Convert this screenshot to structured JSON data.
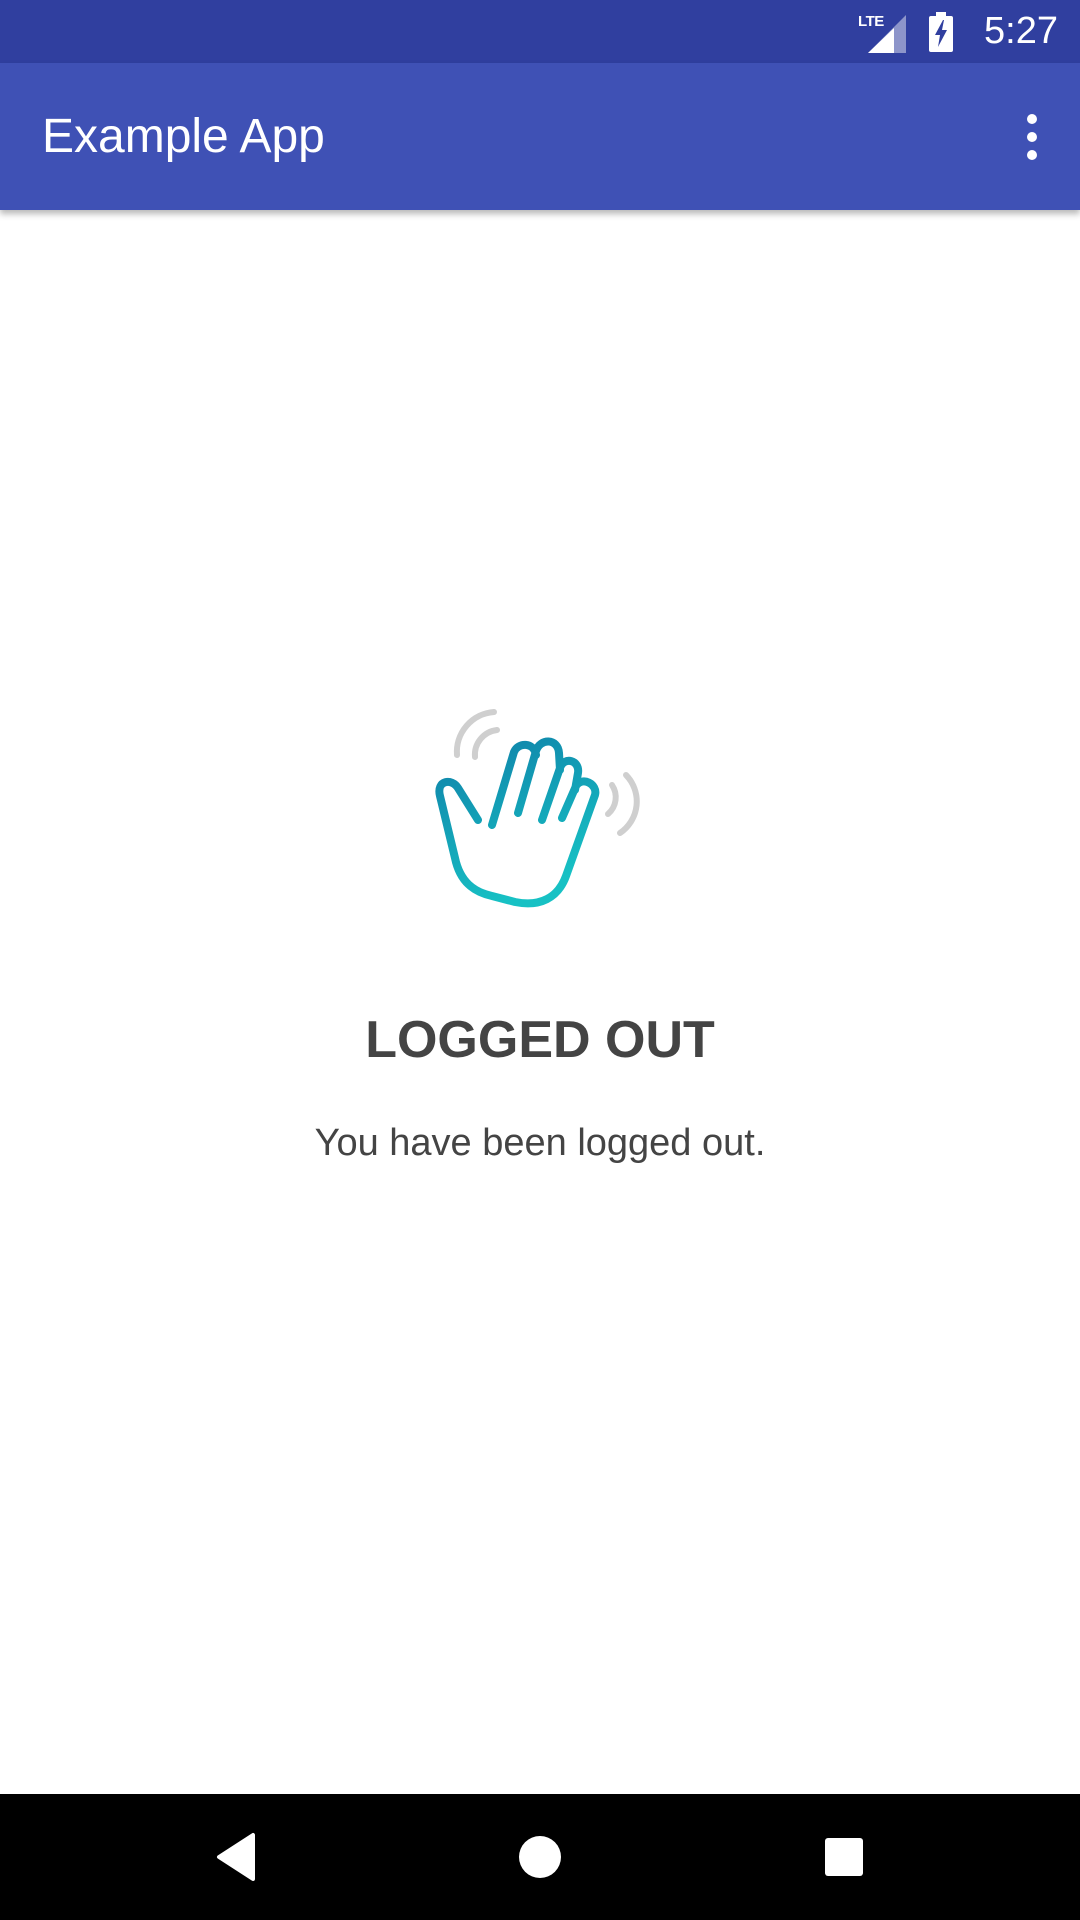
{
  "status_bar": {
    "network_label": "LTE",
    "time": "5:27",
    "background_color": "#303F9F",
    "icons": [
      "lte-signal-icon",
      "battery-charging-icon"
    ]
  },
  "app_bar": {
    "title": "Example App",
    "background_color": "#3F51B5",
    "overflow_icon": "more-vert-icon"
  },
  "content": {
    "illustration_icon": "waving-hand-icon",
    "title": "LOGGED OUT",
    "message": "You have been logged out.",
    "text_color": "#444444"
  },
  "nav_bar": {
    "buttons": [
      "back-icon",
      "home-icon",
      "recents-icon"
    ]
  }
}
